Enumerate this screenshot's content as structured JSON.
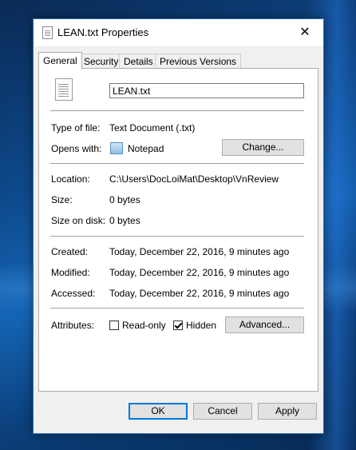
{
  "window": {
    "title": "LEAN.txt Properties",
    "close_glyph": "✕"
  },
  "tabs": [
    {
      "label": "General",
      "active": true
    },
    {
      "label": "Security",
      "active": false
    },
    {
      "label": "Details",
      "active": false
    },
    {
      "label": "Previous Versions",
      "active": false
    }
  ],
  "general": {
    "file_name": "LEAN.txt",
    "file_icon": "text-file-icon",
    "type_label": "Type of file:",
    "type_value": "Text Document (.txt)",
    "opens_label": "Opens with:",
    "opens_value": "Notepad",
    "opens_icon": "notepad-icon",
    "change_button": "Change...",
    "location_label": "Location:",
    "location_value": "C:\\Users\\DocLoiMat\\Desktop\\VnReview",
    "size_label": "Size:",
    "size_value": "0 bytes",
    "size_on_disk_label": "Size on disk:",
    "size_on_disk_value": "0 bytes",
    "created_label": "Created:",
    "created_value": "Today, December 22, 2016, 9 minutes ago",
    "modified_label": "Modified:",
    "modified_value": "Today, December 22, 2016, 9 minutes ago",
    "accessed_label": "Accessed:",
    "accessed_value": "Today, December 22, 2016, 9 minutes ago",
    "attributes_label": "Attributes:",
    "readonly_label": "Read-only",
    "readonly_checked": false,
    "hidden_label": "Hidden",
    "hidden_checked": true,
    "advanced_button": "Advanced..."
  },
  "footer": {
    "ok": "OK",
    "cancel": "Cancel",
    "apply": "Apply"
  },
  "colors": {
    "accent": "#0078d7",
    "window_bg": "#f0f0f0",
    "panel_bg": "#ffffff"
  }
}
